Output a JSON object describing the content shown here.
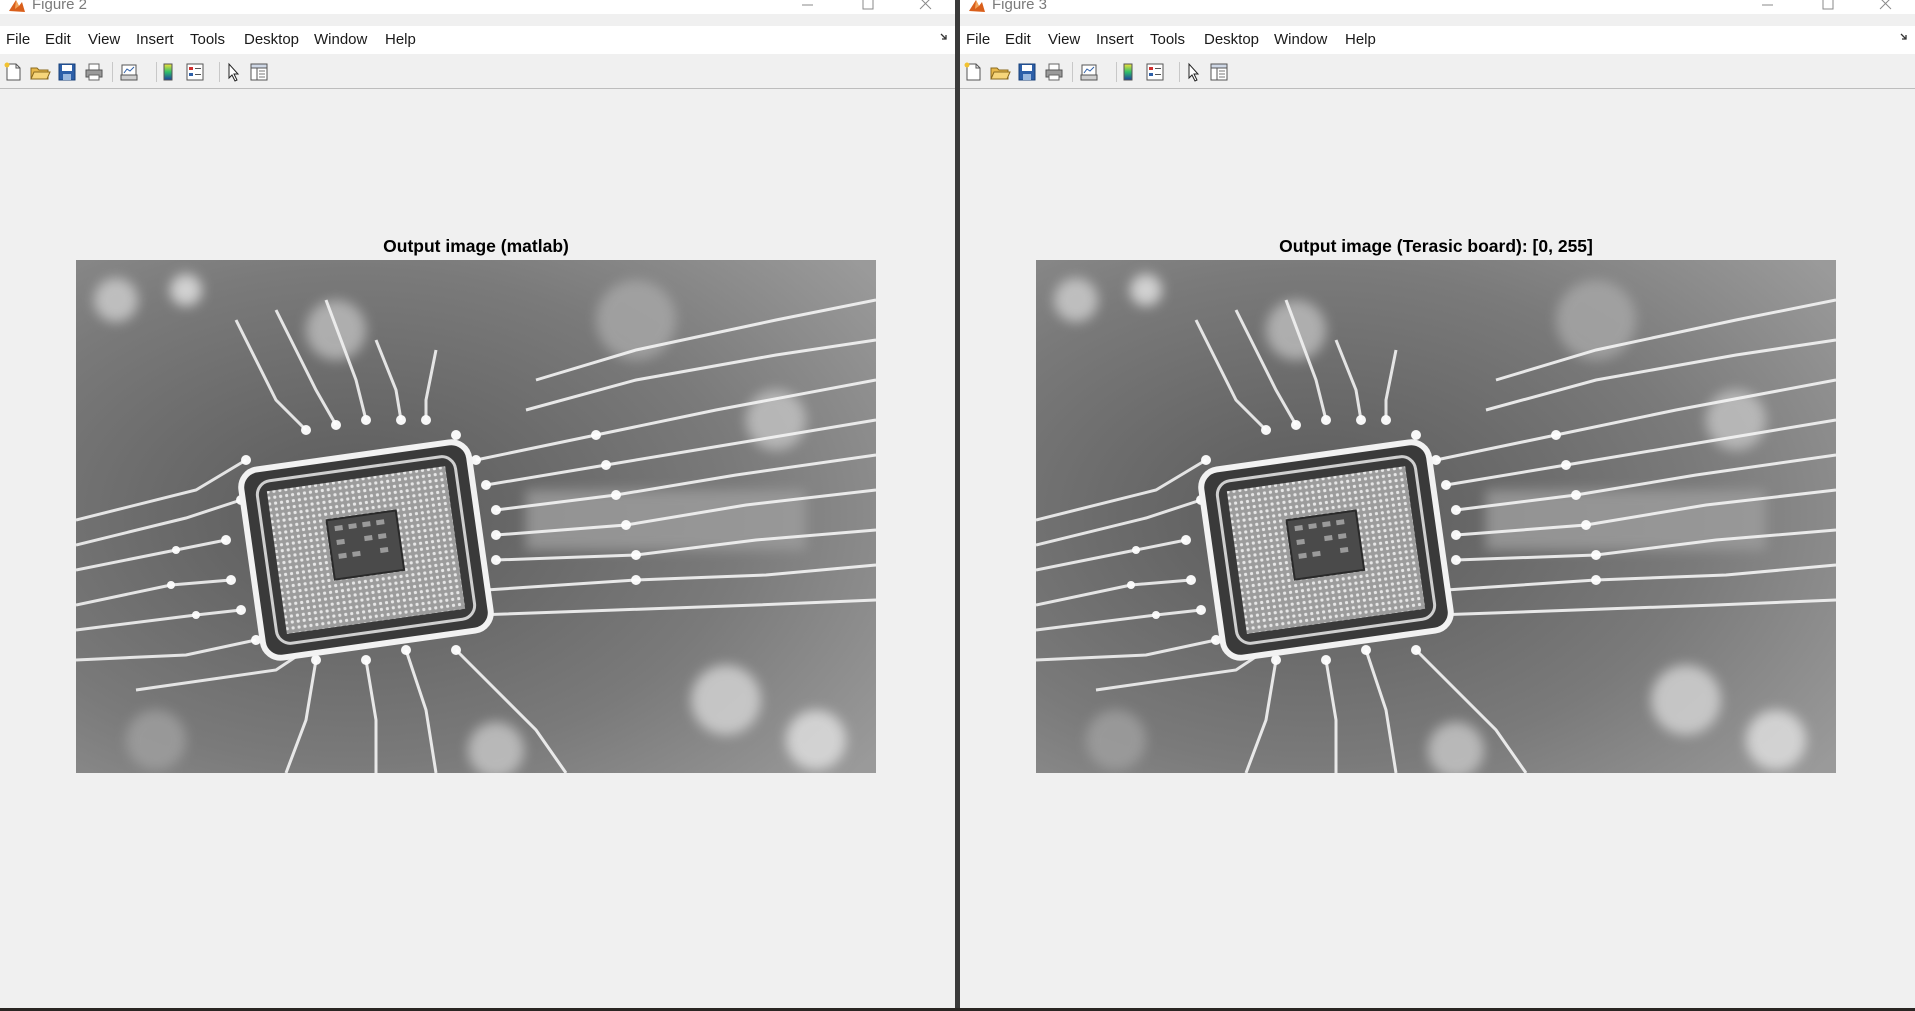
{
  "windows": [
    {
      "title": "Figure 2",
      "menu": [
        "File",
        "Edit",
        "View",
        "Insert",
        "Tools",
        "Desktop",
        "Window",
        "Help"
      ],
      "axes_title": "Output image (matlab)"
    },
    {
      "title": "Figure 3",
      "menu": [
        "File",
        "Edit",
        "View",
        "Insert",
        "Tools",
        "Desktop",
        "Window",
        "Help"
      ],
      "axes_title": "Output image (Terasic board): [0, 255]"
    }
  ],
  "toolbar_icons": [
    "new-figure-icon",
    "open-file-icon",
    "save-icon",
    "print-icon",
    "link-plot-icon",
    "colorbar-icon",
    "legend-icon",
    "edit-plot-icon",
    "property-inspector-icon"
  ],
  "colors": {
    "app_icon": "#d95f1b",
    "window_bg": "#f0f0f0"
  }
}
